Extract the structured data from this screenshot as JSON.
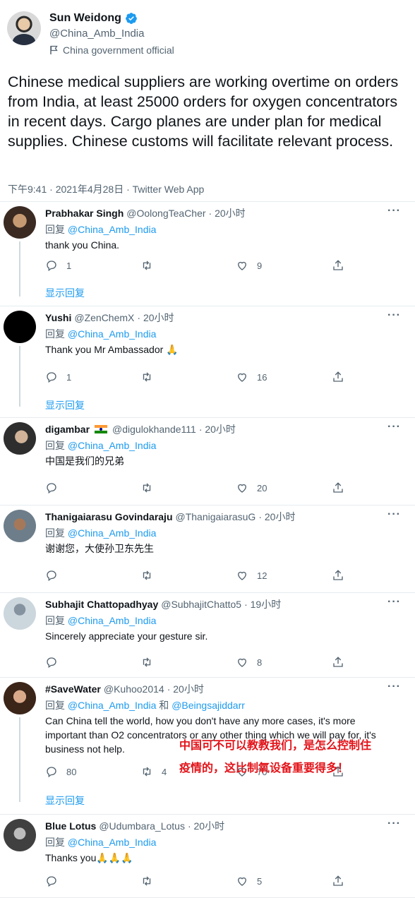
{
  "main_tweet": {
    "name": "Sun Weidong",
    "handle": "@China_Amb_India",
    "label": "China government official",
    "text": "Chinese medical suppliers are working overtime on orders from India, at least 25000 orders for oxygen concentrators in recent days. Cargo planes are under plan for medical supplies. Chinese customs will facilitate relevant process.",
    "meta": "下午9:41 · 2021年4月28日 · Twitter Web App"
  },
  "replying_prefix": "回复",
  "show_replies": "显示回复",
  "replies": [
    {
      "name": "Prabhakar Singh",
      "handle": "@OolongTeaCher",
      "time": "· 20小时",
      "to": "@China_Amb_India",
      "text": "thank you China.",
      "reply_count": "1",
      "retweet_count": "",
      "like_count": "9"
    },
    {
      "name": "Yushi",
      "handle": "@ZenChemX",
      "time": "· 20小时",
      "to": "@China_Amb_India",
      "text": "Thank you Mr Ambassador 🙏",
      "reply_count": "1",
      "retweet_count": "",
      "like_count": "16"
    },
    {
      "name": "digambar",
      "handle": "@digulokhande111",
      "time": "· 20小时",
      "to": "@China_Amb_India",
      "text": "中国是我们的兄弟",
      "reply_count": "",
      "retweet_count": "",
      "like_count": "20"
    },
    {
      "name": "Thanigaiarasu Govindaraju",
      "handle": "@ThanigaiarasuG",
      "time": "· 20小时",
      "to": "@China_Amb_India",
      "text": "谢谢您，大使孙卫东先生",
      "reply_count": "",
      "retweet_count": "",
      "like_count": "12"
    },
    {
      "name": "Subhajit Chattopadhyay",
      "handle": "@SubhajitChatto5",
      "time": "· 19小时",
      "to": "@China_Amb_India",
      "text": "Sincerely appreciate your gesture sir.",
      "reply_count": "",
      "retweet_count": "",
      "like_count": "8"
    },
    {
      "name": "#SaveWater",
      "handle": "@Kuhoo2014",
      "time": "· 20小时",
      "to": "@China_Amb_India",
      "and": "和",
      "to2": "@Beingsajiddarr",
      "text": "Can China tell the world, how you don't have any more cases, it's more important than O2 concentrators or any other thing which we will pay for, it's business not help.",
      "reply_count": "80",
      "retweet_count": "4",
      "like_count": "70"
    },
    {
      "name": "Blue Lotus",
      "handle": "@Udumbara_Lotus",
      "time": "· 20小时",
      "to": "@China_Amb_India",
      "text": "Thanks you🙏🙏🙏",
      "reply_count": "",
      "retweet_count": "",
      "like_count": "5"
    }
  ],
  "overlay": {
    "line1": "中国可不可以教教我们，是怎么控制住",
    "line2": "疫情的，这比制氧设备重要得多！",
    "color": "#e2141a"
  },
  "colors": {
    "link": "#1d9bf0",
    "secondary": "#536471",
    "text": "#0f1419"
  },
  "icons": [
    "verified-icon",
    "flag-icon",
    "reply-icon",
    "retweet-icon",
    "like-icon",
    "share-icon",
    "more-icon"
  ]
}
